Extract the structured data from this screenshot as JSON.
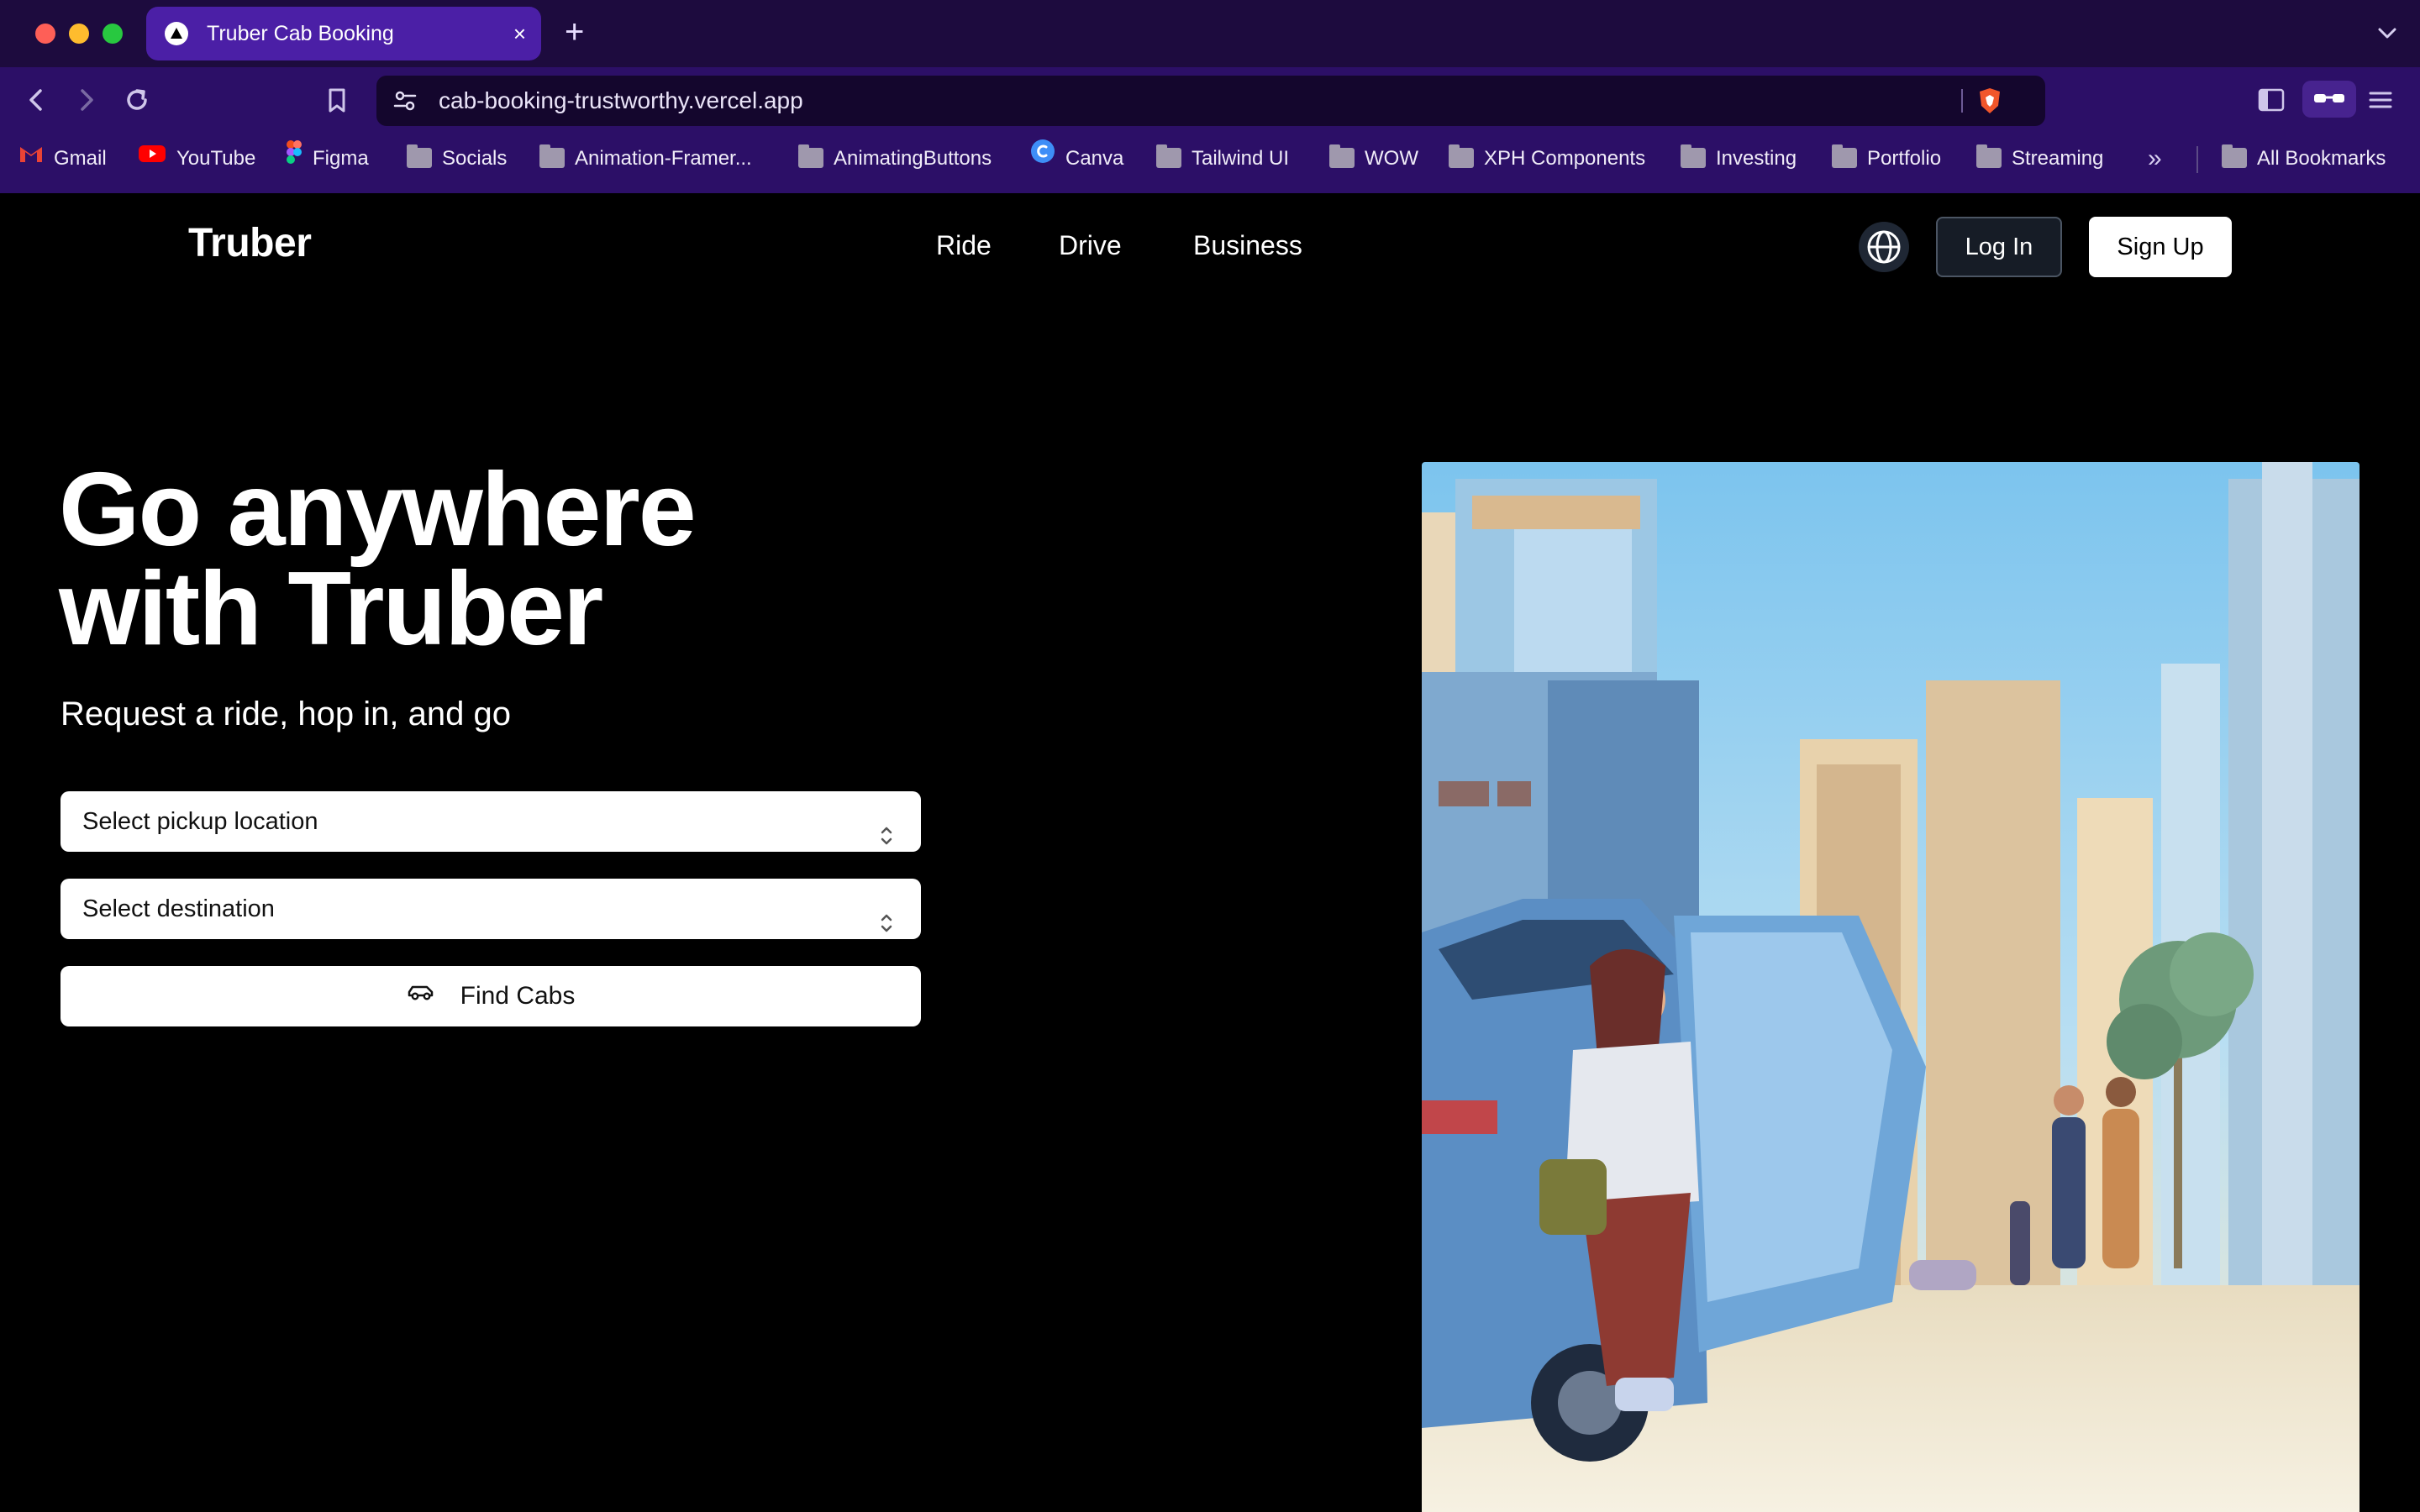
{
  "browser": {
    "tab_title": "Truber Cab Booking",
    "tab_close": "×",
    "new_tab": "+",
    "url": "cab-booking-trustworthy.vercel.app",
    "bookmarks": [
      "Gmail",
      "YouTube",
      "Figma",
      "Socials",
      "Animation-Framer...",
      "AnimatingButtons",
      "Canva",
      "Tailwind UI",
      "WOW",
      "XPH Components",
      "Investing",
      "Portfolio",
      "Streaming"
    ],
    "bookmarks_more": "»",
    "all_bookmarks": "All Bookmarks"
  },
  "header": {
    "logo": "Truber",
    "nav": [
      "Ride",
      "Drive",
      "Business"
    ],
    "login_label": "Log In",
    "signup_label": "Sign Up"
  },
  "hero": {
    "title_line1": "Go anywhere",
    "title_line2": "with Truber",
    "subtitle": "Request a ride, hop in, and go",
    "pickup_placeholder": "Select pickup location",
    "destination_placeholder": "Select destination",
    "find_label": "Find Cabs"
  },
  "colors": {
    "tabbar": "#1d0b3e",
    "toolbar": "#2c0f67",
    "active_tab": "#4b1fa6",
    "page_bg": "#000000"
  }
}
